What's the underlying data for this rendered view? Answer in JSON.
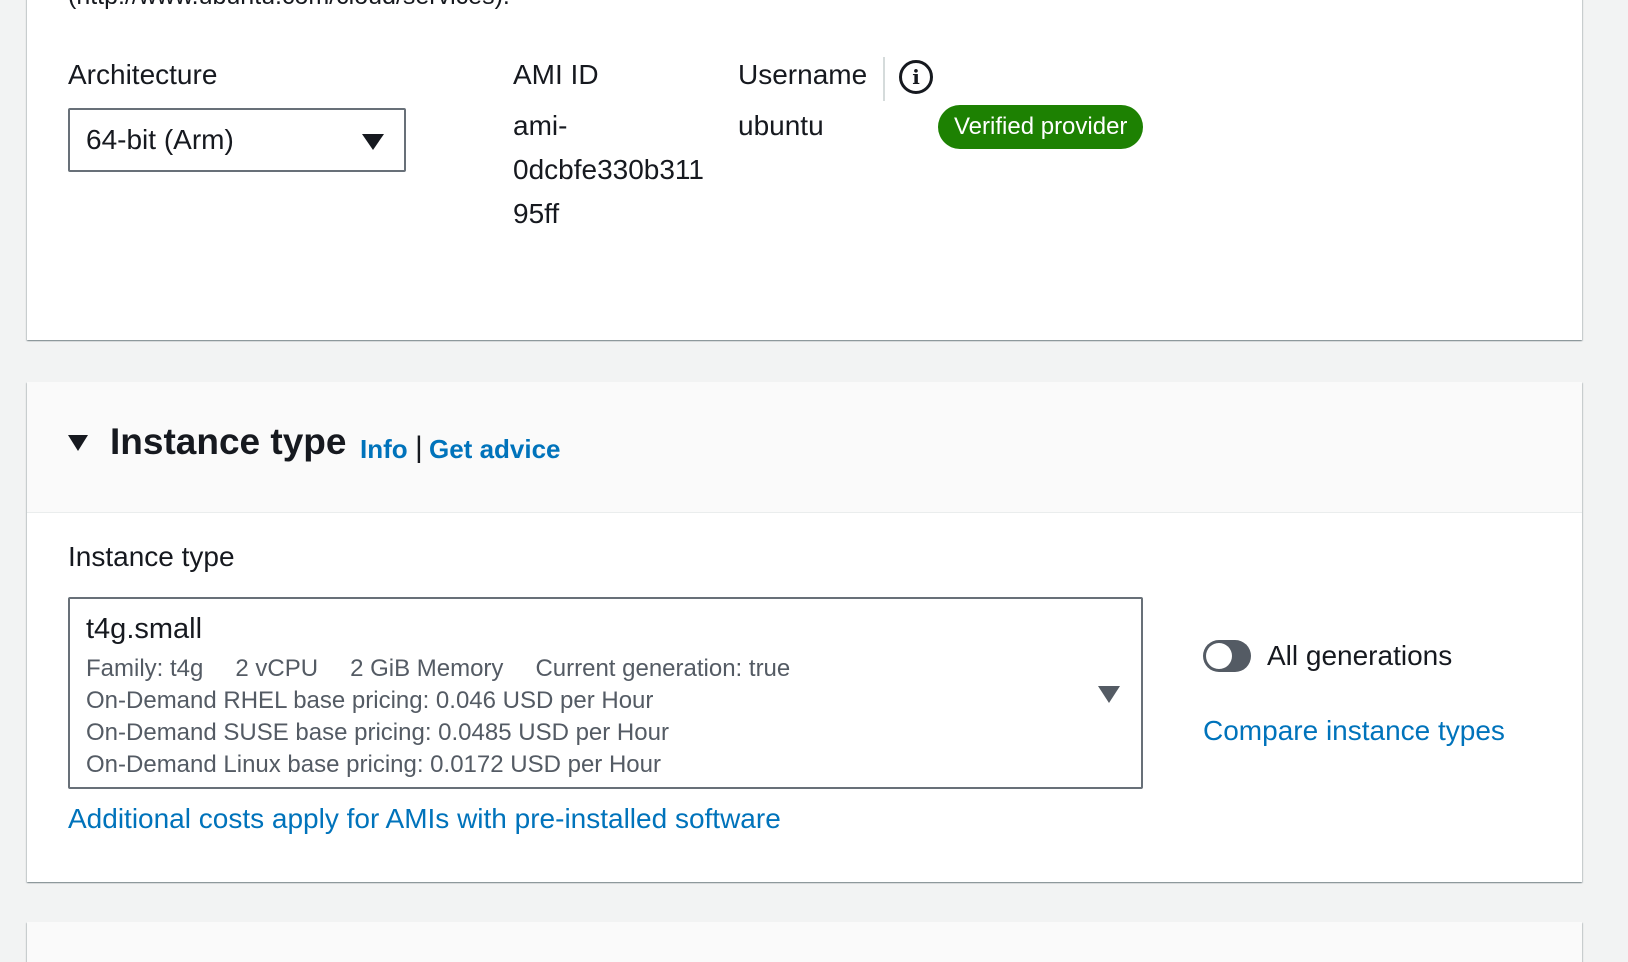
{
  "ami_panel": {
    "cut_off_text": "(http://www.ubuntu.com/cloud/services).",
    "architecture": {
      "label": "Architecture",
      "selected": "64-bit (Arm)"
    },
    "ami_id": {
      "label": "AMI ID",
      "value_line1": "ami-",
      "value_line2": "0dcbfe330b311",
      "value_line3": "95ff"
    },
    "username": {
      "label": "Username",
      "value": "ubuntu"
    },
    "info_icon": "info-circle-icon",
    "badge": {
      "text": "Verified provider",
      "color": "#1d8102"
    }
  },
  "instance_panel": {
    "title": "Instance type",
    "info_link": "Info",
    "separator": "|",
    "advice_link": "Get advice",
    "field_label": "Instance type",
    "selected": {
      "name": "t4g.small",
      "family": "Family: t4g",
      "vcpu": "2 vCPU",
      "memory": "2 GiB Memory",
      "generation": "Current generation: true",
      "rhel_pricing": "On-Demand RHEL base pricing: 0.046 USD per Hour",
      "suse_pricing": "On-Demand SUSE base pricing: 0.0485 USD per Hour",
      "linux_pricing": "On-Demand Linux base pricing: 0.0172 USD per Hour"
    },
    "toggle": {
      "label": "All generations",
      "state": "off"
    },
    "compare_link": "Compare instance types",
    "cost_link": "Additional costs apply for AMIs with pre-installed software"
  },
  "colors": {
    "link": "#0073bb",
    "background": "#f2f3f3",
    "badge_green": "#1d8102"
  }
}
